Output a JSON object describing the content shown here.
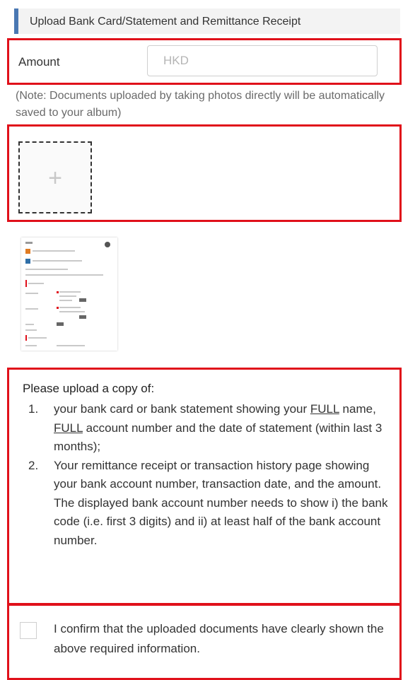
{
  "section": {
    "title": "Upload Bank Card/Statement and Remittance Receipt"
  },
  "amount": {
    "label": "Amount",
    "placeholder": "HKD"
  },
  "note": "(Note: Documents uploaded by taking photos directly will be automatically saved to your album)",
  "upload": {
    "add_symbol": "+"
  },
  "instructions": {
    "intro": "Please upload a copy of:",
    "items": [
      {
        "number": "1.",
        "pre": "your bank card or bank statement showing your ",
        "full1": "FULL",
        "mid": " name, ",
        "full2": "FULL",
        "post": " account number and the date of statement (within last 3 months);"
      },
      {
        "number": "2.",
        "text": "Your remittance receipt or transaction history page showing your bank account number, transaction date, and the amount. The displayed bank account number needs to show i) the bank code (i.e. first 3 digits) and ii) at least half of the bank account number."
      }
    ]
  },
  "confirm": {
    "text": "I confirm that the uploaded documents have clearly shown the above required information."
  },
  "colors": {
    "accent": "#4a78b3",
    "highlight_border": "#e0101a",
    "sample_orange": "#e07b22",
    "sample_blue": "#2f6fa8"
  }
}
